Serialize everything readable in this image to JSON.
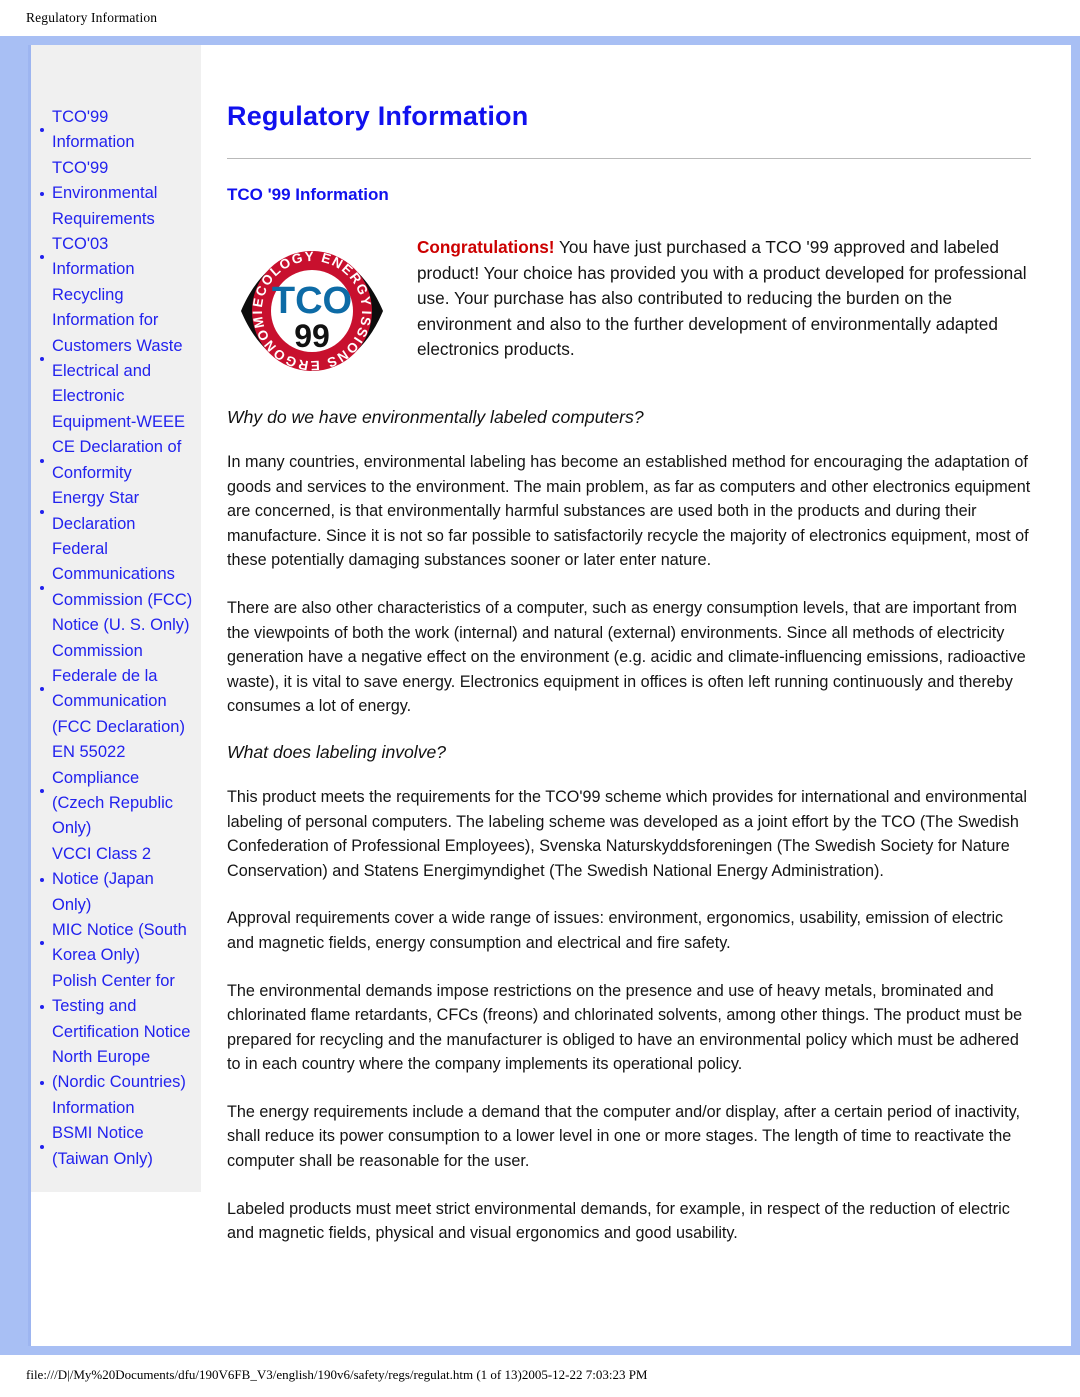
{
  "running_head": "Regulatory Information",
  "colors": {
    "frame_blue": "#a8bff4",
    "link_blue": "#2222ee",
    "title_blue": "#1111ee",
    "congrats_red": "#cc0000",
    "sidebar_gray": "#f0f0f0"
  },
  "sidebar": {
    "items": [
      {
        "label": "TCO'99 Information"
      },
      {
        "label": "TCO'99 Environmental Requirements"
      },
      {
        "label": "TCO'03 Information"
      },
      {
        "label": "Recycling Information for Customers Waste Electrical and Electronic Equipment-WEEE"
      },
      {
        "label": "CE Declaration of Conformity"
      },
      {
        "label": "Energy Star Declaration"
      },
      {
        "label": "Federal Communications Commission (FCC) Notice (U. S. Only)"
      },
      {
        "label": "Commission Federale de la Communication (FCC Declaration)"
      },
      {
        "label": "EN 55022 Compliance (Czech Republic Only)"
      },
      {
        "label": "VCCI Class 2 Notice (Japan Only)"
      },
      {
        "label": "MIC Notice (South Korea Only)"
      },
      {
        "label": "Polish Center for Testing and Certification Notice"
      },
      {
        "label": "North Europe (Nordic Countries) Information"
      },
      {
        "label": "BSMI Notice (Taiwan Only)"
      }
    ]
  },
  "main": {
    "title": "Regulatory Information",
    "section_title": "TCO '99 Information",
    "logo": {
      "name": "tco-99-certification-logo",
      "center_text": "TCO",
      "year_text": "99",
      "ring_words_top": "ECOLOGY ENERGY",
      "ring_words_bottom": "EMISSIONS ERGONOMICS"
    },
    "intro": {
      "lead": "Congratulations!",
      "rest": " You have just purchased a TCO '99 approved and labeled product! Your choice has provided you with a product developed for professional use. Your purchase has also contributed to reducing the burden on the environment and also to the further development of environmentally adapted electronics products."
    },
    "heading_1": "Why do we have environmentally labeled computers?",
    "para_1": "In many countries, environmental labeling has become an established method for encouraging the adaptation of goods and services to the environment. The main problem, as far as computers and other electronics equipment are concerned, is that environmentally harmful substances are used both in the products and during their manufacture. Since it is not so far possible to satisfactorily recycle the majority of electronics equipment, most of these potentially damaging substances sooner or later enter nature.",
    "para_2": "There are also other characteristics of a computer, such as energy consumption levels, that are important from the viewpoints of both the work (internal) and natural (external) environments. Since all methods of electricity generation have a negative effect on the environment (e.g. acidic and climate-influencing emissions, radioactive waste), it is vital to save energy. Electronics equipment in offices is often left running continuously and thereby consumes a lot of energy.",
    "heading_2": "What does labeling involve?",
    "para_3": "This product meets the requirements for the TCO'99 scheme which provides for international and environmental labeling of personal computers. The labeling scheme was developed as a joint effort by the TCO (The Swedish Confederation of Professional Employees), Svenska Naturskyddsforeningen (The Swedish Society for Nature Conservation) and Statens Energimyndighet (The Swedish National Energy Administration).",
    "para_4": "Approval requirements cover a wide range of issues: environment, ergonomics, usability, emission of electric and magnetic fields, energy consumption and electrical and fire safety.",
    "para_5": "The environmental demands impose restrictions on the presence and use of heavy metals, brominated and chlorinated flame retardants, CFCs (freons) and chlorinated solvents, among other things. The product must be prepared for recycling and the manufacturer is obliged to have an environmental policy which must be adhered to in each country where the company implements its operational policy.",
    "para_6": "The energy requirements include a demand that the computer and/or display, after a certain period of inactivity, shall reduce its power consumption to a lower level in one or more stages. The length of time to reactivate the computer shall be reasonable for the user.",
    "para_7": "Labeled products must meet strict environmental demands, for example, in respect of the reduction of electric and magnetic fields, physical and visual ergonomics and good usability."
  },
  "footer": {
    "status": "file:///D|/My%20Documents/dfu/190V6FB_V3/english/190v6/safety/regs/regulat.htm (1 of 13)2005-12-22 7:03:23 PM"
  }
}
